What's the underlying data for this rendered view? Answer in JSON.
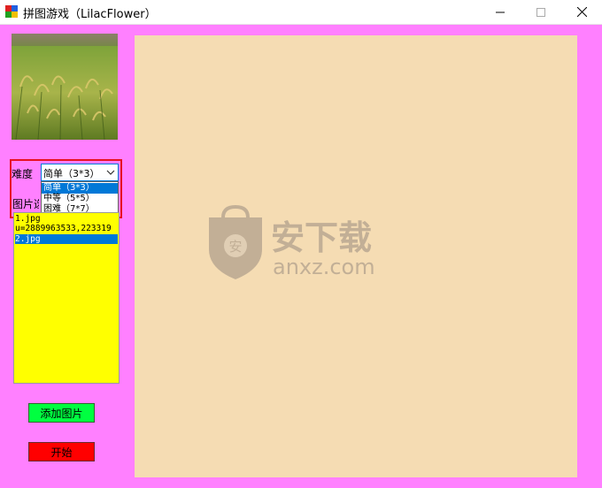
{
  "window": {
    "title": "拼图游戏（LilacFlower）",
    "controls": [
      "minimize-icon",
      "maximize-icon",
      "close-icon"
    ]
  },
  "sidebar": {
    "difficulty_label": "难度",
    "difficulty_selected": "简单（3*3）",
    "difficulty_options": [
      "简单（3*3）",
      "中等（5*5）",
      "困难（7*7）"
    ],
    "image_list_label": "图片选",
    "image_list_items": [
      "1.jpg",
      "u=2889963533,223319",
      "2.jpg"
    ],
    "selected_image_index": 2,
    "add_button": "添加图片",
    "start_button": "开始"
  },
  "watermark": {
    "text": "安下载",
    "url": "anxz.com",
    "badge": "安"
  },
  "colors": {
    "client_bg": "#ff80ff",
    "board_bg": "#f5dcb3",
    "list_bg": "#ffff00",
    "add_button_bg": "#00ff40",
    "start_button_bg": "#ff0000",
    "highlight": "#e81123",
    "selection": "#0078d7"
  }
}
